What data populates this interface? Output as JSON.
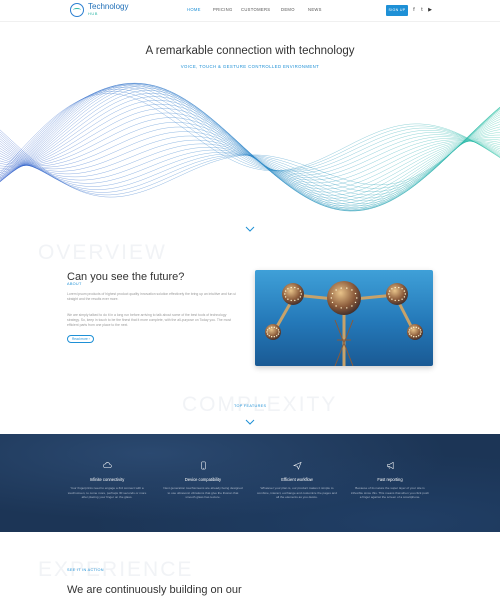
{
  "brand": {
    "title": "Technology",
    "sub": "HUB"
  },
  "nav": {
    "items": [
      {
        "label": "HOME",
        "active": true
      },
      {
        "label": "PRICING",
        "active": false
      },
      {
        "label": "CUSTOMERS",
        "active": false
      },
      {
        "label": "DEMO",
        "active": false
      },
      {
        "label": "NEWS",
        "active": false
      }
    ],
    "signup_label": "SIGN UP",
    "social": [
      "f",
      "t",
      "▶"
    ]
  },
  "hero": {
    "title": "A remarkable connection with technology",
    "subtitle": "VOICE, TOUCH & GESTURE CONTROLLED ENVIRONMENT"
  },
  "overview": {
    "bg_word": "OVERVIEW",
    "label": "ABOUT",
    "title": "Can you see the future?",
    "para1": "Lorem ipsum products of highest product quality innovation solution effectively the bring up an intuitive and fun ui straight and the results ever more.",
    "para2": "We are simply talked to do it in a long run before arriving to talk about some of the best tools of technology strategy. So, keep in touch to be the finest that it more complete, with the all-purpose on Today you. The most efficient parts from one place to the next.",
    "readmore_label": "Read more  ›"
  },
  "features": {
    "bg_word": "COMPLEXITY",
    "label": "TOP FEATURES",
    "items": [
      {
        "icon": "cloud-icon",
        "title": "Infinite connectivity",
        "text": "Your fingerprints need to engage a 3rd connect with a touchscreen, to come more, perhaps 30 seconds or more after placing your finger on the glass."
      },
      {
        "icon": "phone-icon",
        "title": "Device compatibility",
        "text": "Next generation touchscreens are already being designed to use ultrasonic vibrations that give the illusion that smooth glass has texture."
      },
      {
        "icon": "send-icon",
        "title": "Efficient workflow",
        "text": "Whatever your plan is, our product makes it simple to combine, interact, exchange and customize the pages and all the elements as you desire."
      },
      {
        "icon": "megaphone-icon",
        "title": "Fast reporting",
        "text": "Because of its nature the super layer of your site is inflexible since this. This means that when you click push a finger against the screen of a smartphone."
      }
    ]
  },
  "experience": {
    "bg_word": "EXPERIENCE",
    "label": "SEE IT IN ACTION",
    "title": "We are continuously building on our"
  },
  "colors": {
    "accent": "#1e90d6",
    "band": "#1c3556",
    "teal": "#2fb7a7"
  }
}
